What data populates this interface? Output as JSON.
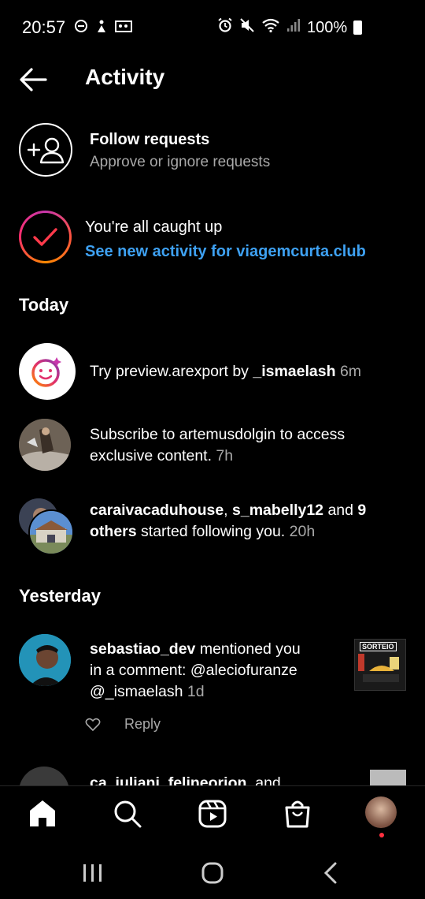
{
  "status_bar": {
    "time": "20:57",
    "battery": "100%"
  },
  "header": {
    "title": "Activity"
  },
  "follow_requests": {
    "title": "Follow requests",
    "subtitle": "Approve or ignore requests"
  },
  "caught_up": {
    "title": "You're all caught up",
    "link": "See new activity for viagemcurta.club"
  },
  "sections": {
    "today": "Today",
    "yesterday": "Yesterday"
  },
  "today": [
    {
      "pre": "Try preview.arexport by ",
      "bold": "_ismaelash",
      "time": "6m"
    },
    {
      "line1": "Subscribe to artemusdolgin to access",
      "line2": "exclusive content. ",
      "time": "7h"
    },
    {
      "user1": "caraivacaduhouse",
      "sep": ", ",
      "user2": "s_mabelly12",
      "and": " and ",
      "others": "9",
      "others2": "others",
      "rest": " started following you. ",
      "time": "20h"
    }
  ],
  "yesterday": [
    {
      "user": "sebastiao_dev",
      "line1": " mentioned you",
      "line2": "in a comment: @aleciofuranze",
      "line3": "@_ismaelash ",
      "time": "1d",
      "reply": "Reply",
      "thumb_text": "SORTEIO"
    },
    {
      "user": "ca_iuliani_felineorion",
      "rest": ", and"
    }
  ],
  "colors": {
    "link": "#3ea1f2",
    "muted": "#a8a8a8",
    "notification_dot": "#ff3040"
  }
}
